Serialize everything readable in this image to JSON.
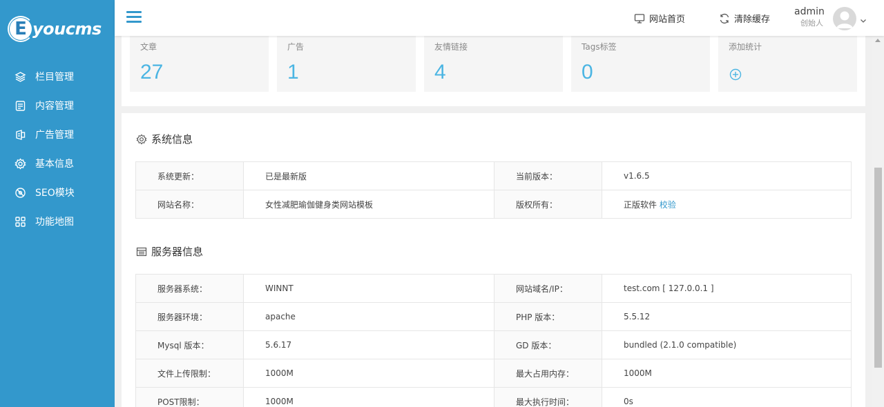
{
  "brand": {
    "logo_letter": "E",
    "logo_text": "youcms"
  },
  "sidebar": {
    "items": [
      {
        "label": "栏目管理",
        "icon": "layers-icon"
      },
      {
        "label": "内容管理",
        "icon": "document-icon"
      },
      {
        "label": "广告管理",
        "icon": "ad-icon"
      },
      {
        "label": "基本信息",
        "icon": "gear-icon"
      },
      {
        "label": "SEO模块",
        "icon": "seo-icon"
      },
      {
        "label": "功能地图",
        "icon": "grid-icon"
      }
    ]
  },
  "header": {
    "home_label": "网站首页",
    "cache_label": "清除缓存",
    "user_name": "admin",
    "user_role": "创始人"
  },
  "stats": [
    {
      "label": "文章",
      "value": "27"
    },
    {
      "label": "广告",
      "value": "1"
    },
    {
      "label": "友情链接",
      "value": "4"
    },
    {
      "label": "Tags标签",
      "value": "0"
    },
    {
      "label": "添加统计",
      "value": ""
    }
  ],
  "system_info": {
    "title": "系统信息",
    "rows": [
      {
        "k1": "系统更新：",
        "v1": "已是最新版",
        "k2": "当前版本：",
        "v2": "v1.6.5"
      },
      {
        "k1": "网站名称：",
        "v1": "女性减肥瑜伽健身类网站模板",
        "k2": "版权所有：",
        "v2": "正版软件",
        "v2_link": "校验"
      }
    ]
  },
  "server_info": {
    "title": "服务器信息",
    "rows": [
      {
        "k1": "服务器系统：",
        "v1": "WINNT",
        "k2": "网站域名/IP：",
        "v2": "test.com [ 127.0.0.1 ]"
      },
      {
        "k1": "服务器环境：",
        "v1": "apache",
        "k2": "PHP 版本：",
        "v2": "5.5.12"
      },
      {
        "k1": "Mysql 版本：",
        "v1": "5.6.17",
        "k2": "GD 版本：",
        "v2": "bundled (2.1.0 compatible)"
      },
      {
        "k1": "文件上传限制：",
        "v1": "1000M",
        "k2": "最大占用内存：",
        "v2": "1000M"
      },
      {
        "k1": "POST限制：",
        "v1": "1000M",
        "k2": "最大执行时间：",
        "v2": "0s"
      }
    ]
  },
  "colors": {
    "sidebar": "#3398cc",
    "accent": "#4bb5e3",
    "link": "#3398cc"
  }
}
